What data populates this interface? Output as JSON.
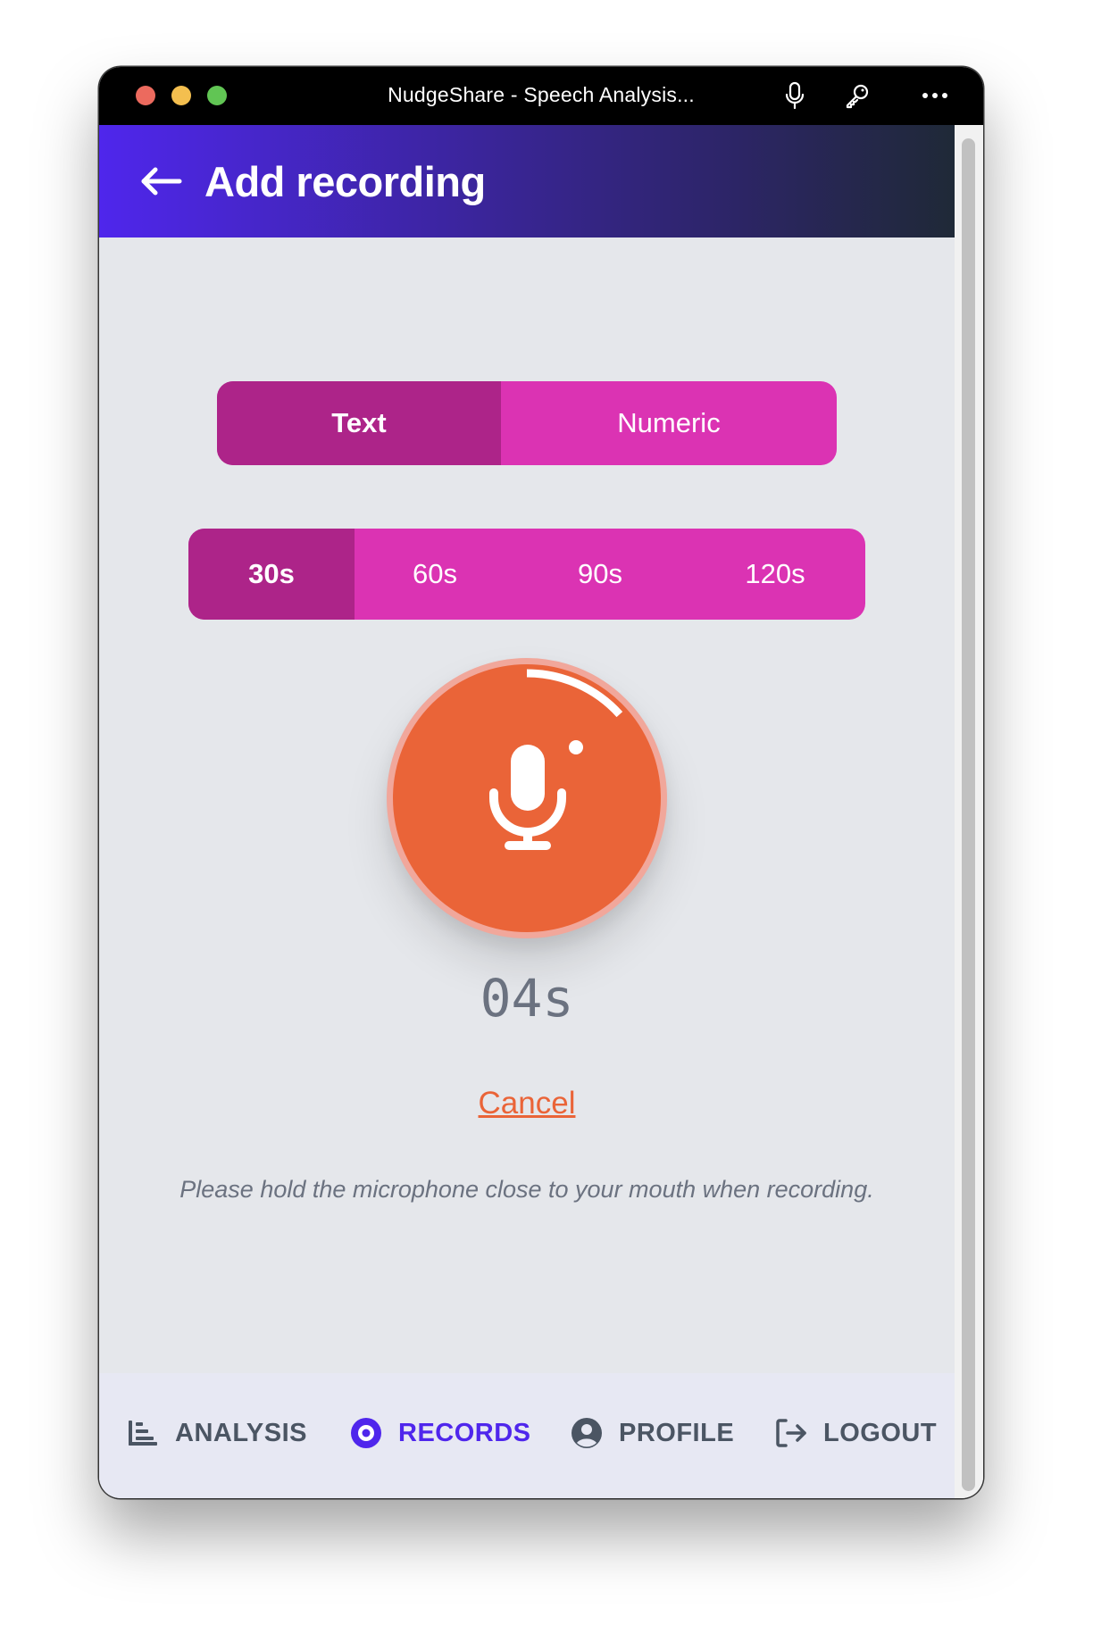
{
  "window": {
    "title": "NudgeShare - Speech Analysis..."
  },
  "header": {
    "title": "Add recording",
    "back_icon": "arrow-left-icon"
  },
  "mode_selector": {
    "options": [
      "Text",
      "Numeric"
    ],
    "selected": "Text"
  },
  "duration_selector": {
    "options": [
      "30s",
      "60s",
      "90s",
      "120s"
    ],
    "selected": "30s"
  },
  "recorder": {
    "icon": "microphone-icon",
    "elapsed": "04s",
    "progress_fraction": 0.133,
    "cancel_label": "Cancel",
    "hint": "Please hold the microphone close to your mouth when recording."
  },
  "bottom_nav": {
    "items": [
      {
        "label": "ANALYSIS",
        "icon": "bar-chart-icon",
        "active": false
      },
      {
        "label": "RECORDS",
        "icon": "record-disc-icon",
        "active": true
      },
      {
        "label": "PROFILE",
        "icon": "user-circle-icon",
        "active": false
      },
      {
        "label": "LOGOUT",
        "icon": "logout-icon",
        "active": false
      }
    ]
  },
  "colors": {
    "accent": "#4f26ec",
    "segment": "#db33b3",
    "segment_active": "#ad2489",
    "record": "#ea6438"
  }
}
